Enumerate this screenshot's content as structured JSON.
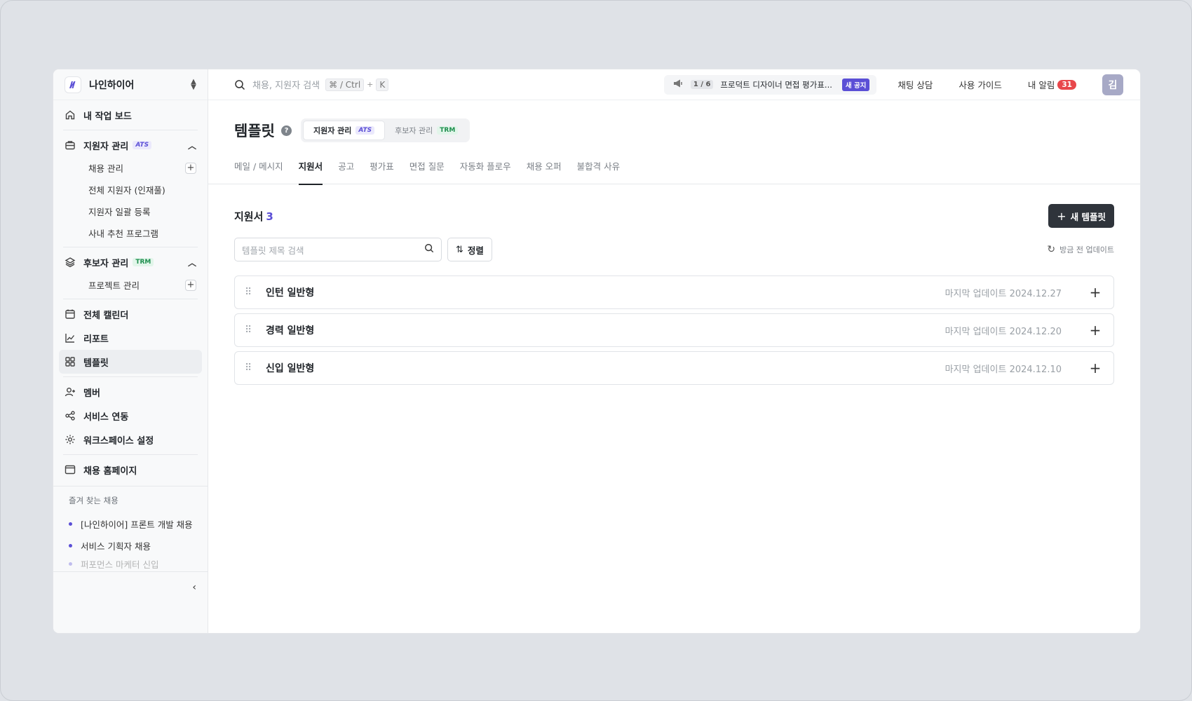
{
  "workspace": {
    "name": "나인하이어"
  },
  "nav": {
    "dashboard": "내 작업 보드",
    "ats": {
      "label": "지원자 관리",
      "badge": "ATS"
    },
    "ats_items": [
      "채용 관리",
      "전체 지원자 (인재풀)",
      "지원자 일괄 등록",
      "사내 추천 프로그램"
    ],
    "trm": {
      "label": "후보자 관리",
      "badge": "TRM"
    },
    "trm_items": [
      "프로젝트 관리"
    ],
    "calendar": "전체 캘린더",
    "report": "리포트",
    "template": "템플릿",
    "member": "멤버",
    "integration": "서비스 연동",
    "settings": "워크스페이스 설정",
    "homepage": "채용 홈페이지"
  },
  "favorites": {
    "title": "즐겨 찾는 채용",
    "items": [
      "[나인하이어] 프론트 개발 채용",
      "서비스 기획자 채용",
      "퍼포먼스 마케터 신입"
    ]
  },
  "topbar": {
    "search_placeholder": "채용, 지원자 검색",
    "shortcut_1": "⌘ / Ctrl",
    "shortcut_plus": "+",
    "shortcut_2": "K",
    "notice_count": "1 / 6",
    "notice_text": "프로덕트 디자이너 면접 평가표...",
    "notice_badge": "새 공지",
    "chat": "채팅 상담",
    "guide": "사용 가이드",
    "alarm": "내 알림",
    "alarm_count": "31",
    "avatar": "김"
  },
  "page": {
    "title": "템플릿",
    "help": "?",
    "seg": [
      {
        "label": "지원자 관리",
        "badge": "ATS"
      },
      {
        "label": "후보자 관리",
        "badge": "TRM"
      }
    ],
    "tabs": [
      "메일 / 메시지",
      "지원서",
      "공고",
      "평가표",
      "면접 질문",
      "자동화 플로우",
      "채용 오퍼",
      "불합격 사유"
    ]
  },
  "section": {
    "title": "지원서",
    "count": "3",
    "new_button": "새 템플릿",
    "search_placeholder": "템플릿 제목 검색",
    "sort": "정렬",
    "updated": "방금 전 업데이트"
  },
  "templates": [
    {
      "title": "인턴 일반형",
      "date": "마지막 업데이트 2024.12.27"
    },
    {
      "title": "경력 일반형",
      "date": "마지막 업데이트 2024.12.20"
    },
    {
      "title": "신입 일반형",
      "date": "마지막 업데이트 2024.12.10"
    }
  ]
}
